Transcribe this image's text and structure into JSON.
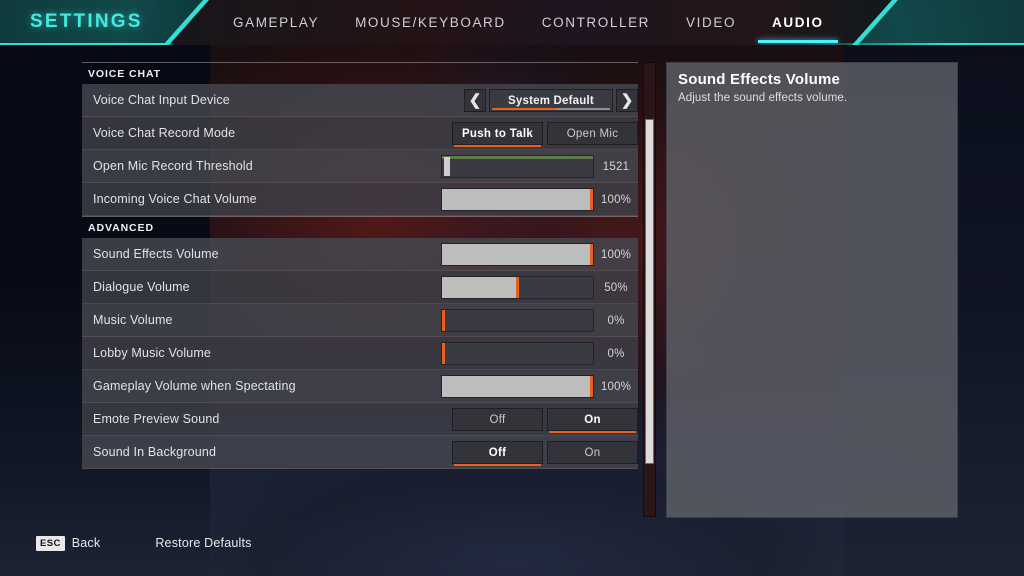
{
  "header": {
    "title": "SETTINGS",
    "tabs": [
      {
        "label": "GAMEPLAY",
        "active": false
      },
      {
        "label": "MOUSE/KEYBOARD",
        "active": false
      },
      {
        "label": "CONTROLLER",
        "active": false
      },
      {
        "label": "VIDEO",
        "active": false
      },
      {
        "label": "AUDIO",
        "active": true
      }
    ],
    "accent_cyan": "#45ebe2",
    "accent_purple": "#8b1fb3"
  },
  "settings": {
    "sections": [
      {
        "title": "VOICE CHAT",
        "rows": [
          {
            "label": "Voice Chat Input Device",
            "control": "dropdown",
            "value": "System Default",
            "prev_icon": "chevron-left-icon",
            "next_icon": "chevron-right-icon"
          },
          {
            "label": "Voice Chat Record Mode",
            "control": "toggle",
            "options": [
              "Push to Talk",
              "Open Mic"
            ],
            "selected": "Push to Talk"
          },
          {
            "label": "Open Mic Record Threshold",
            "control": "threshold",
            "value": "1521",
            "percent": 3
          },
          {
            "label": "Incoming Voice Chat Volume",
            "control": "slider",
            "value": "100%",
            "percent": 100
          }
        ]
      },
      {
        "title": "ADVANCED",
        "rows": [
          {
            "label": "Sound Effects Volume",
            "control": "slider",
            "value": "100%",
            "percent": 100
          },
          {
            "label": "Dialogue Volume",
            "control": "slider",
            "value": "50%",
            "percent": 50
          },
          {
            "label": "Music Volume",
            "control": "slider",
            "value": "0%",
            "percent": 0
          },
          {
            "label": "Lobby Music Volume",
            "control": "slider",
            "value": "0%",
            "percent": 0
          },
          {
            "label": "Gameplay Volume when Spectating",
            "control": "slider",
            "value": "100%",
            "percent": 100
          },
          {
            "label": "Emote Preview Sound",
            "control": "toggle",
            "options": [
              "Off",
              "On"
            ],
            "selected": "On"
          },
          {
            "label": "Sound In Background",
            "control": "toggle",
            "options": [
              "Off",
              "On"
            ],
            "selected": "Off"
          }
        ]
      }
    ]
  },
  "info": {
    "title": "Sound Effects Volume",
    "description": "Adjust the sound effects volume."
  },
  "footer": {
    "back_key": "ESC",
    "back_label": "Back",
    "restore_label": "Restore Defaults"
  },
  "colors": {
    "slider_fill": "#bdbdbd",
    "slider_knob": "#e8601f",
    "selected_underline": "#e8601f",
    "threshold_meter": "#5f7b4a"
  }
}
